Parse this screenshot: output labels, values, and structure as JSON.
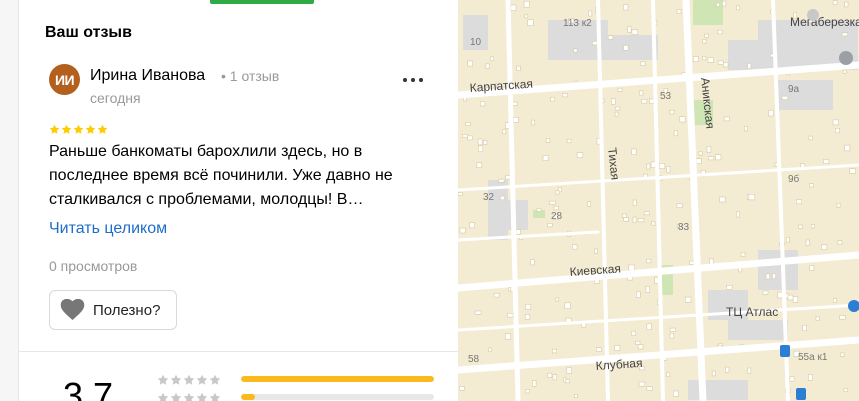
{
  "review_section": {
    "title": "Ваш отзыв",
    "author": {
      "initials": "ИИ",
      "name": "Ирина Иванова",
      "meta": "• 1 отзыв",
      "date": "сегодня"
    },
    "rating": 5,
    "text": "Раньше банкоматы барохлили здесь, но в последнее время всё починили. Уже давно не сталкивался с проблемами, молодцы! В…",
    "read_more": "Читать целиком",
    "views": "0 просмотров",
    "helpful_label": "Полезно?"
  },
  "rating_summary": {
    "average": "3,7",
    "distribution": [
      {
        "stars": 5,
        "fraction": 1.0
      },
      {
        "stars": 4,
        "fraction": 0.07
      }
    ]
  },
  "map": {
    "streets": [
      "Карпатская",
      "Аникская",
      "Тихая",
      "Киевская",
      "Клубная"
    ],
    "places": [
      "Мегаберезка",
      "ТЦ Атлас"
    ],
    "house_numbers": [
      "113 к2",
      "10",
      "53",
      "9а",
      "9б",
      "32",
      "28",
      "83",
      "58",
      "55а к1"
    ]
  },
  "colors": {
    "accent_green": "#2eab45",
    "link_blue": "#1e6ec8",
    "star_yellow": "#ffcc00",
    "bar_yellow": "#fcb91c",
    "avatar_brown": "#b3601f",
    "map_background": "#f3ebd2"
  }
}
